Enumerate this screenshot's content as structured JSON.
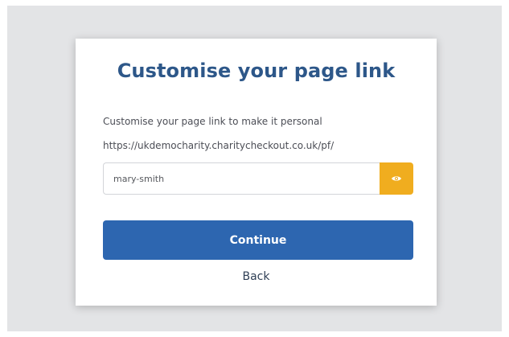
{
  "dialog": {
    "title": "Customise your page link",
    "description": "Customise your page link to make it personal",
    "url_prefix": "https://ukdemocharity.charitycheckout.co.uk/pf/",
    "slug_input": {
      "value": "mary-smith",
      "placeholder": ""
    },
    "preview_icon": "eye-icon",
    "continue_label": "Continue",
    "back_label": "Back"
  },
  "colors": {
    "title": "#2d5789",
    "primary_button": "#2d66b0",
    "preview_button": "#f0ad1f",
    "backdrop": "#e3e4e6"
  }
}
